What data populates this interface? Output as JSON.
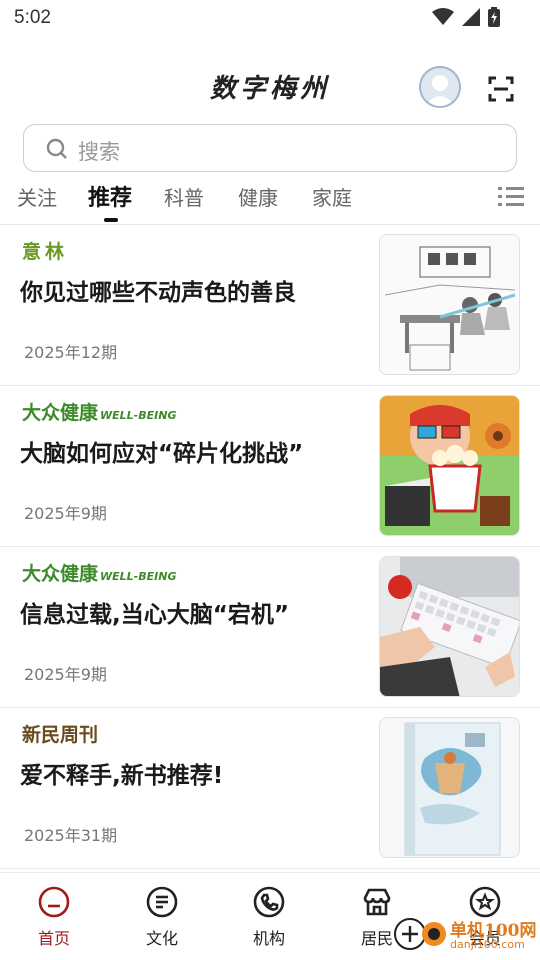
{
  "status": {
    "time": "5:02"
  },
  "header": {
    "title": "数字梅州"
  },
  "search": {
    "placeholder": "搜索"
  },
  "tabs": [
    {
      "label": "关注"
    },
    {
      "label": "推荐",
      "active": true
    },
    {
      "label": "科普"
    },
    {
      "label": "健康"
    },
    {
      "label": "家庭"
    }
  ],
  "articles": [
    {
      "source": "意林",
      "source_color": "#6a9a1f",
      "title": "你见过哪些不动声色的善良",
      "issue": "2025年12期",
      "thumb": "sketch-illustration"
    },
    {
      "source": "大众健康",
      "source_sub": "WELL-BEING",
      "source_color": "#3e8a2a",
      "title": "大脑如何应对“碎片化挑战”",
      "issue": "2025年9期",
      "thumb": "popcorn-movie-illustration"
    },
    {
      "source": "大众健康",
      "source_sub": "WELL-BEING",
      "source_color": "#3e8a2a",
      "title": "信息过载,当心大脑“宕机”",
      "issue": "2025年9期",
      "thumb": "keyboard-photo"
    },
    {
      "source": "新民周刊",
      "source_color": "#6b4a1e",
      "title": "爱不释手,新书推荐!",
      "issue": "2025年31期",
      "thumb": "book-cover"
    }
  ],
  "bottom_nav": [
    {
      "label": "首页",
      "icon": "home-icon",
      "active": true
    },
    {
      "label": "文化",
      "icon": "document-icon"
    },
    {
      "label": "机构",
      "icon": "phone-icon"
    },
    {
      "label": "居民",
      "icon": "store-icon"
    },
    {
      "label": "会员",
      "icon": "star-icon"
    }
  ],
  "watermark": {
    "text": "单机100网",
    "sub": "danji100.com"
  },
  "colors": {
    "accent": "#9e1b1b",
    "tab_active": "#111111"
  }
}
